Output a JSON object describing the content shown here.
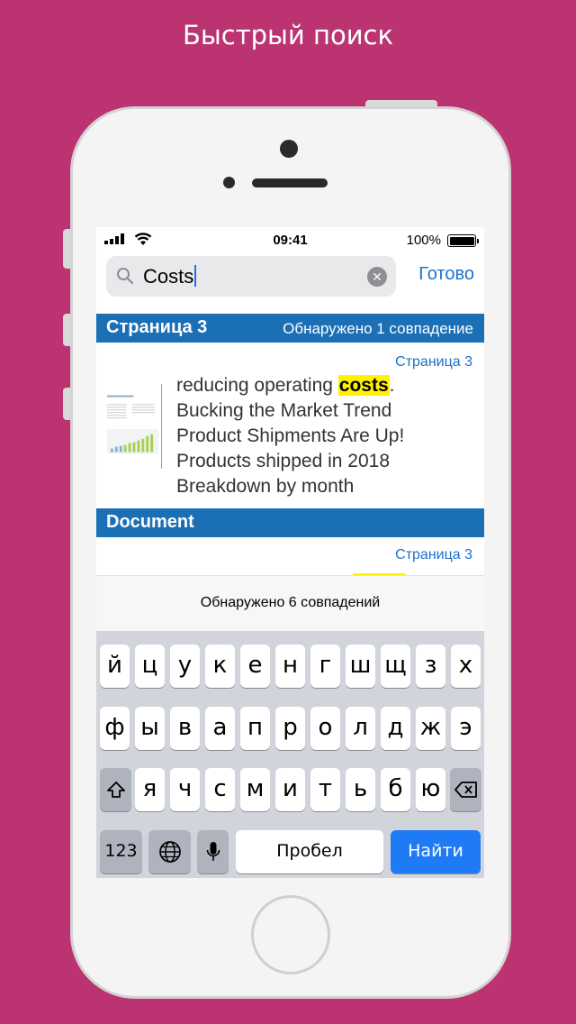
{
  "promo": {
    "title": "Быстрый поиск"
  },
  "status_bar": {
    "time": "09:41",
    "battery": "100%"
  },
  "search": {
    "query": "Costs",
    "done_label": "Готово",
    "clear_icon": "clear-icon"
  },
  "results": {
    "sections": [
      {
        "title": "Страница 3",
        "count": "Обнаружено 1 совпадение"
      },
      {
        "title": "Document",
        "count": ""
      }
    ],
    "items": [
      {
        "page_label": "Страница 3",
        "lines": [
          {
            "before": "reducing operating ",
            "highlight": "costs",
            "after": "."
          },
          {
            "before": "Bucking the Market Trend",
            "highlight": "",
            "after": ""
          },
          {
            "before": "Product Shipments Are Up!",
            "highlight": "",
            "after": ""
          },
          {
            "before": "Products shipped in 2018",
            "highlight": "",
            "after": ""
          },
          {
            "before": "Breakdown by month",
            "highlight": "",
            "after": ""
          }
        ]
      },
      {
        "page_label": "Страница 3"
      }
    ]
  },
  "match_summary": "Обнаружено 6 совпадений",
  "keyboard": {
    "row1": [
      "й",
      "ц",
      "у",
      "к",
      "е",
      "н",
      "г",
      "ш",
      "щ",
      "з",
      "х"
    ],
    "row2": [
      "ф",
      "ы",
      "в",
      "а",
      "п",
      "р",
      "о",
      "л",
      "д",
      "ж",
      "э"
    ],
    "row3": [
      "я",
      "ч",
      "с",
      "м",
      "и",
      "т",
      "ь",
      "б",
      "ю"
    ],
    "numbers_label": "123",
    "space_label": "Пробел",
    "search_label": "Найти",
    "accent_color": "#1F7BF5"
  },
  "colors": {
    "background": "#BB3471",
    "section_header": "#1A6FB5",
    "highlight": "#FFF200"
  }
}
